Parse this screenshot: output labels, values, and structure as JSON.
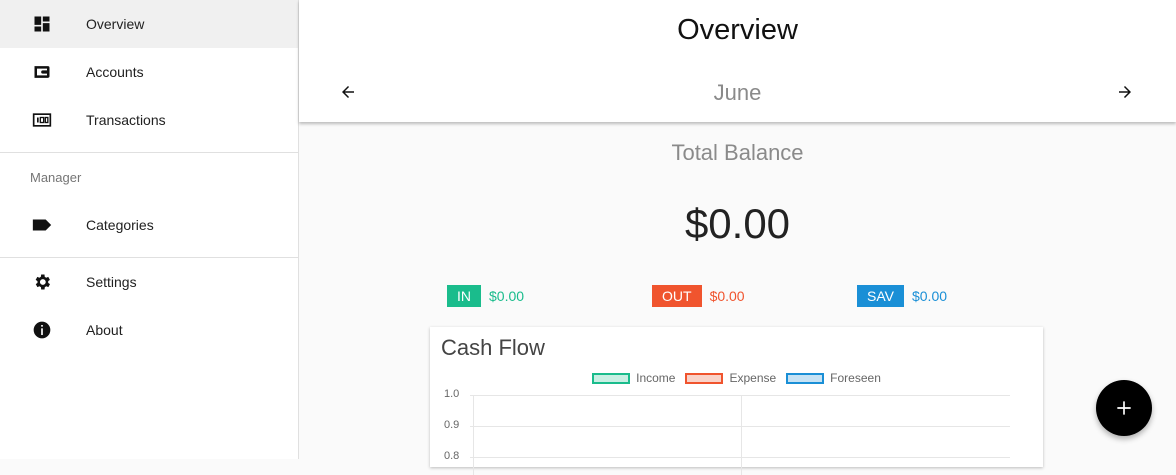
{
  "sidebar": {
    "items": [
      {
        "label": "Overview",
        "icon": "dashboard-icon"
      },
      {
        "label": "Accounts",
        "icon": "wallet-icon"
      },
      {
        "label": "Transactions",
        "icon": "money-icon"
      }
    ],
    "manager_header": "Manager",
    "manager_items": [
      {
        "label": "Categories",
        "icon": "label-icon"
      }
    ],
    "bottom_items": [
      {
        "label": "Settings",
        "icon": "gear-icon"
      },
      {
        "label": "About",
        "icon": "info-icon"
      }
    ]
  },
  "header": {
    "title": "Overview",
    "month": "June"
  },
  "balance": {
    "label": "Total Balance",
    "value": "$0.00"
  },
  "stats": {
    "in": {
      "badge": "IN",
      "value": "$0.00",
      "color": "#1abc8c"
    },
    "out": {
      "badge": "OUT",
      "value": "$0.00",
      "color": "#f0542e"
    },
    "sav": {
      "badge": "SAV",
      "value": "$0.00",
      "color": "#1a8fd6"
    }
  },
  "chart_data": {
    "type": "line",
    "title": "Cash Flow",
    "series": [
      {
        "name": "Income",
        "values": []
      },
      {
        "name": "Expense",
        "values": []
      },
      {
        "name": "Foreseen",
        "values": []
      }
    ],
    "y_ticks": [
      "1.0",
      "0.9",
      "0.8"
    ],
    "ylim": [
      0,
      1.0
    ],
    "grid": true,
    "legend_position": "top",
    "colors": {
      "Income": "#1abc8c",
      "Expense": "#f0542e",
      "Foreseen": "#1a8fd6"
    }
  },
  "fab": {
    "icon": "plus-icon"
  }
}
